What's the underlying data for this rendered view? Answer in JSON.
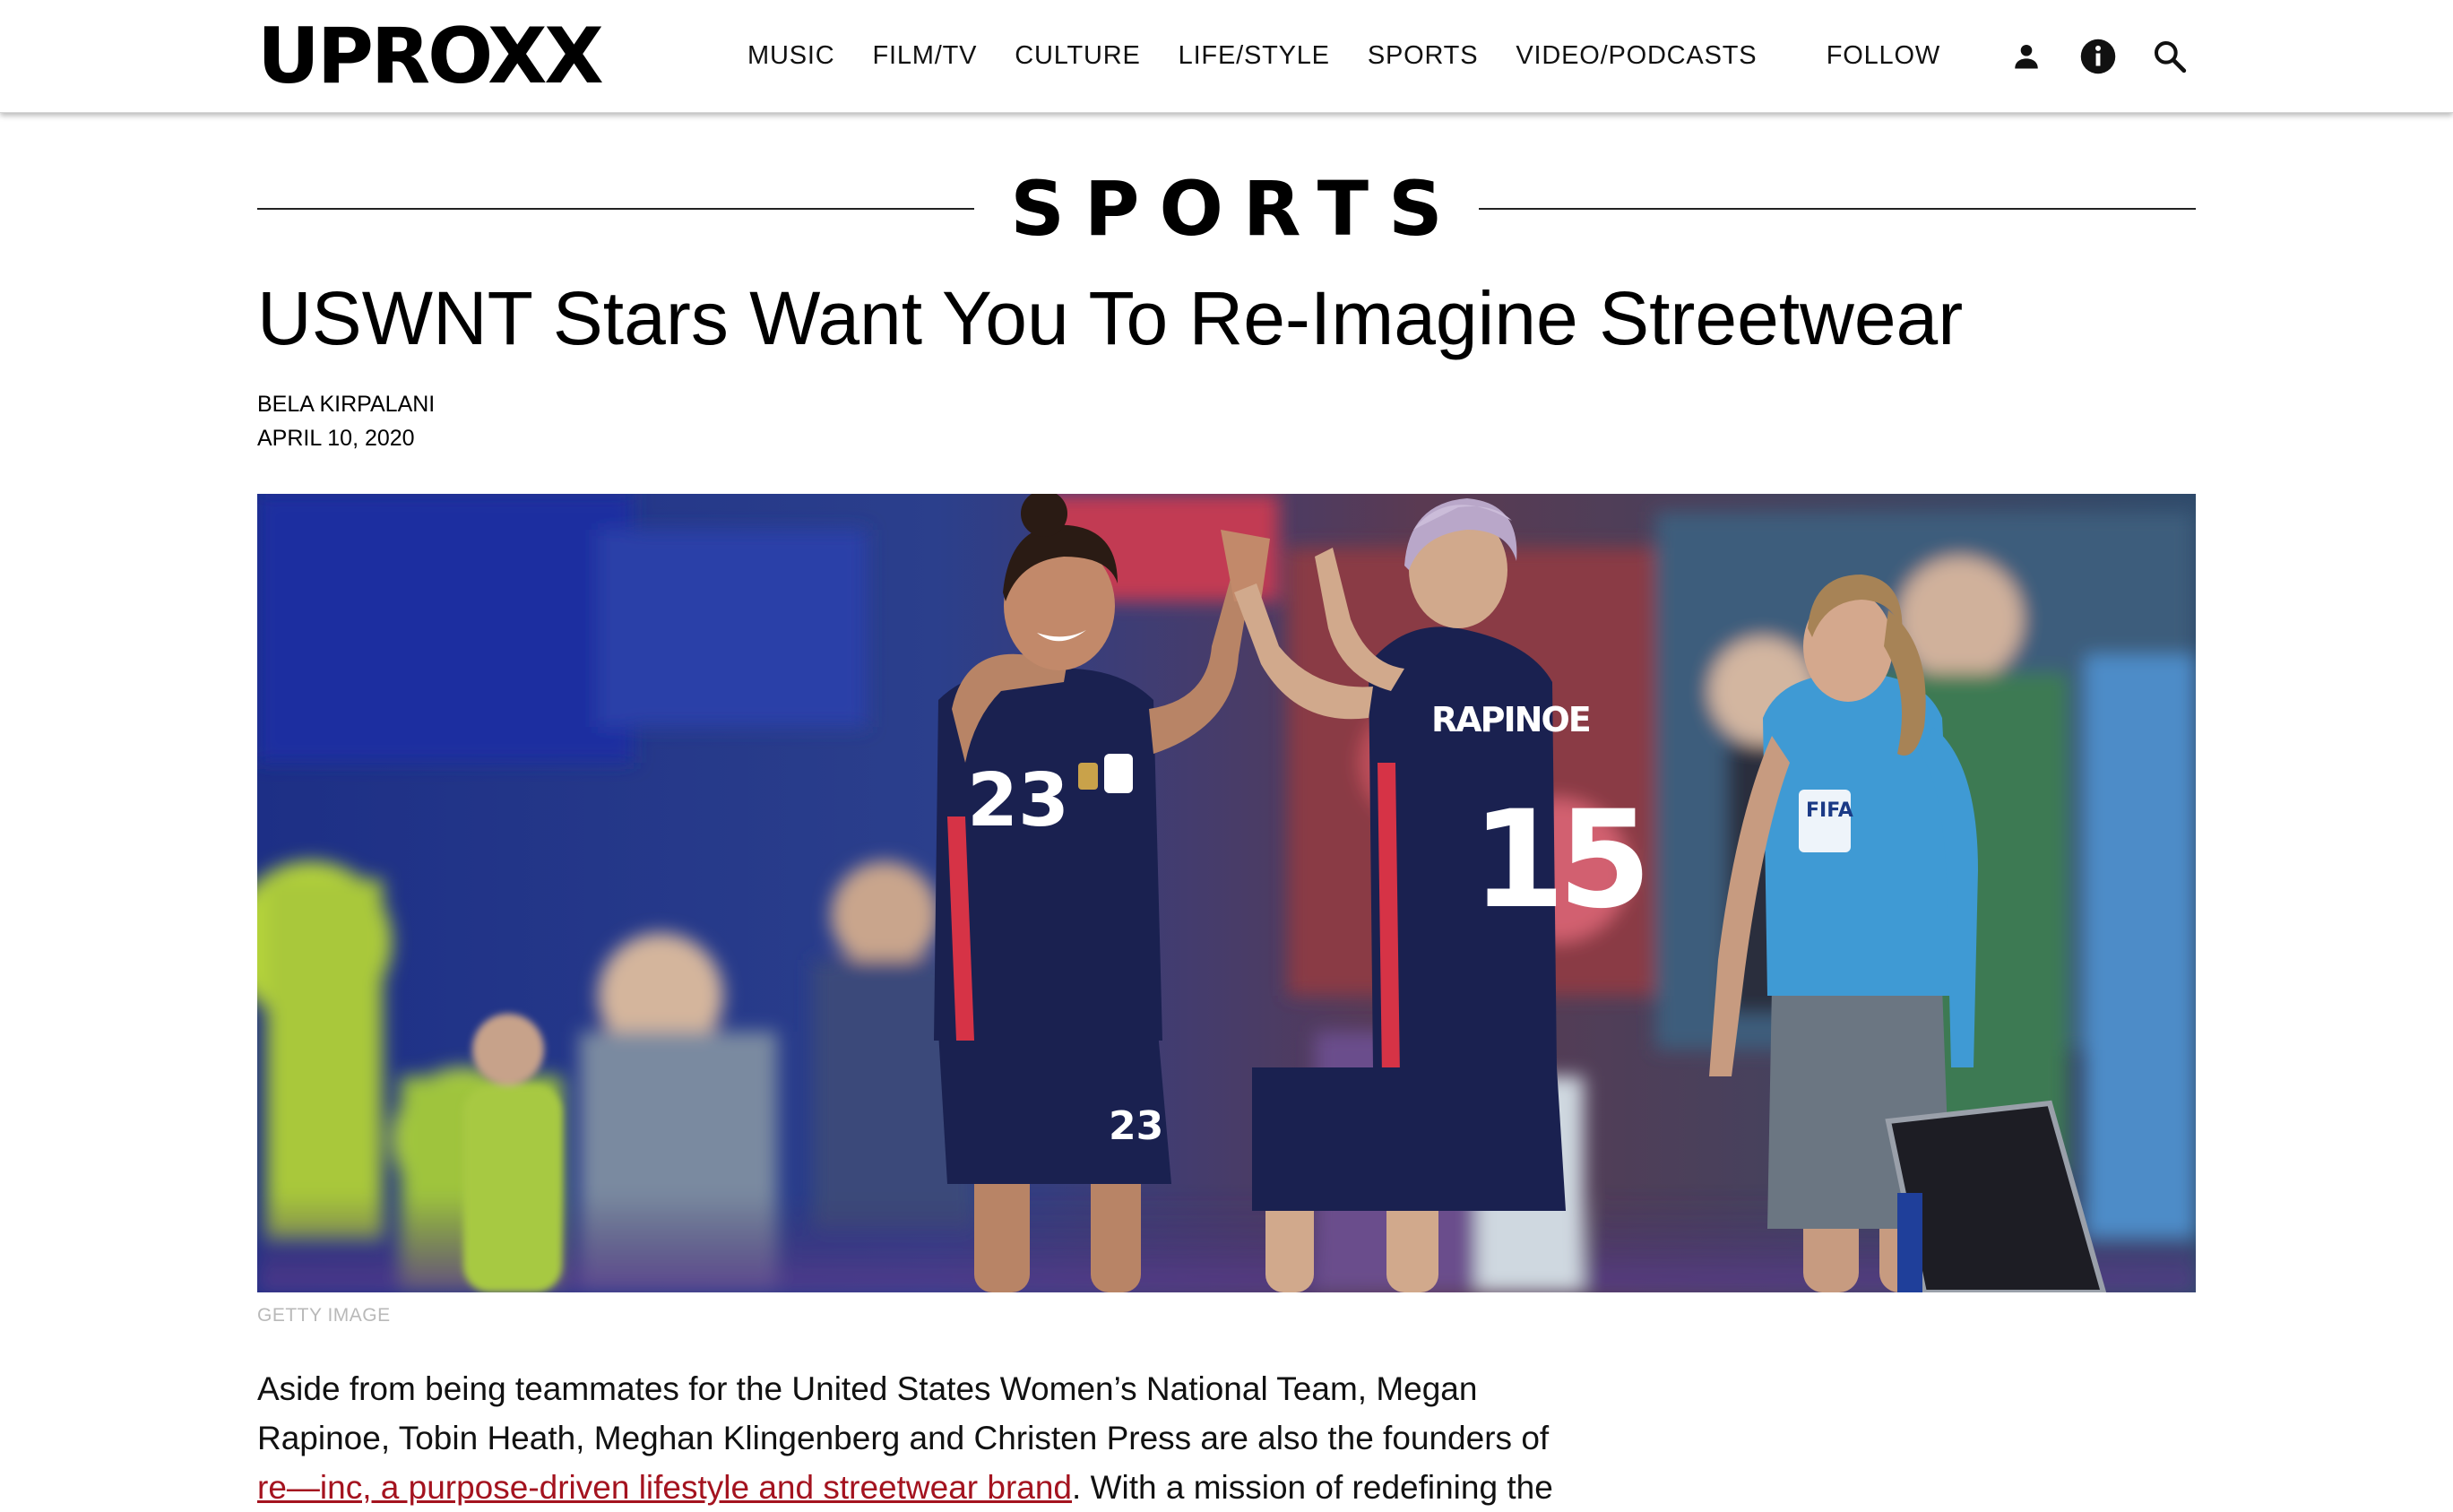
{
  "header": {
    "logo": "UPROXX",
    "nav": [
      "MUSIC",
      "FILM/TV",
      "CULTURE",
      "LIFE/STYLE",
      "SPORTS",
      "VIDEO/PODCASTS"
    ],
    "follow_label": "FOLLOW",
    "icons": [
      "user-icon",
      "info-icon",
      "search-icon"
    ]
  },
  "section": {
    "title": "SPORTS"
  },
  "article": {
    "headline": "USWNT Stars Want You To Re-Imagine Streetwear",
    "author": "BELA KIRPALANI",
    "date": "APRIL 10, 2020",
    "image_credit": "GETTY IMAGE",
    "hero_jersey_numbers": [
      "23",
      "15"
    ],
    "hero_jersey_name": "RAPINOE",
    "hero_badge": "FIFA",
    "paragraph_line1": "Aside from being teammates for the United States Women’s National Team, Megan",
    "paragraph_line2": "Rapinoe, Tobin Heath, Meghan Klingenberg and Christen Press are also the founders of",
    "paragraph_link": "re—inc, a purpose-driven lifestyle and streetwear brand",
    "paragraph_after_link": ". With a mission of redefining the"
  },
  "colors": {
    "link": "#a4131f",
    "jersey_navy": "#1a2150",
    "referee_blue": "#3f9ad4",
    "stadium_blue": "#1c2f7a"
  }
}
